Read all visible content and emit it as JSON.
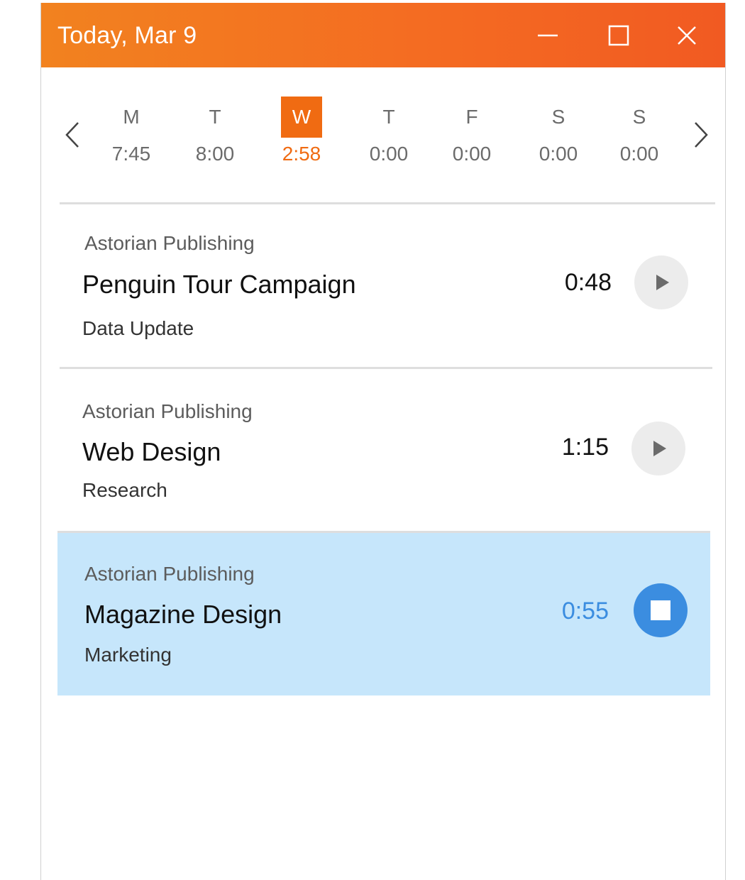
{
  "window": {
    "title": "Today, Mar 9",
    "accent_color": "#f06b12",
    "controls": [
      "minimize-icon",
      "maximize-icon",
      "close-icon"
    ]
  },
  "week": {
    "prev_icon": "chevron-left-icon",
    "next_icon": "chevron-right-icon",
    "days": [
      {
        "letter": "M",
        "time": "7:45",
        "selected": false
      },
      {
        "letter": "T",
        "time": "8:00",
        "selected": false
      },
      {
        "letter": "W",
        "time": "2:58",
        "selected": true
      },
      {
        "letter": "T",
        "time": "0:00",
        "selected": false
      },
      {
        "letter": "F",
        "time": "0:00",
        "selected": false
      },
      {
        "letter": "S",
        "time": "0:00",
        "selected": false
      },
      {
        "letter": "S",
        "time": "0:00",
        "selected": false
      }
    ]
  },
  "entries": [
    {
      "client": "Astorian Publishing",
      "project": "Penguin Tour Campaign",
      "task": "Data Update",
      "duration": "0:48",
      "running": false,
      "action_icon": "play-icon"
    },
    {
      "client": "Astorian Publishing",
      "project": "Web Design",
      "task": "Research",
      "duration": "1:15",
      "running": false,
      "action_icon": "play-icon"
    },
    {
      "client": "Astorian Publishing",
      "project": "Magazine Design",
      "task": "Marketing",
      "duration": "0:55",
      "running": true,
      "action_icon": "stop-icon"
    }
  ],
  "colors": {
    "running_background": "#c6e6fb",
    "running_accent": "#3b8de0"
  }
}
